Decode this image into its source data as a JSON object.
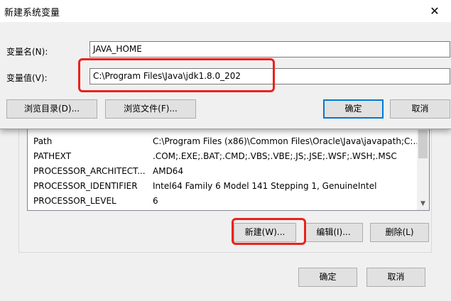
{
  "dialog": {
    "title": "新建系统变量",
    "variable_name_label": "变量名(N):",
    "variable_name_value": "JAVA_HOME",
    "variable_value_label": "变量值(V):",
    "variable_value_value": "C:\\Program Files\\Java\\jdk1.8.0_202",
    "browse_directory_button": "浏览目录(D)...",
    "browse_file_button": "浏览文件(F)...",
    "ok_button": "确定",
    "cancel_button": "取消"
  },
  "system_variables": {
    "rows": [
      {
        "name": "Path",
        "value": "C:\\Program Files (x86)\\Common Files\\Oracle\\Java\\javapath;C:..."
      },
      {
        "name": "PATHEXT",
        "value": ".COM;.EXE;.BAT;.CMD;.VBS;.VBE;.JS;.JSE;.WSF;.WSH;.MSC"
      },
      {
        "name": "PROCESSOR_ARCHITECT...",
        "value": "AMD64"
      },
      {
        "name": "PROCESSOR_IDENTIFIER",
        "value": "Intel64 Family 6 Model 141 Stepping 1, GenuineIntel"
      },
      {
        "name": "PROCESSOR_LEVEL",
        "value": "6"
      }
    ],
    "new_button": "新建(W)...",
    "edit_button": "编辑(I)...",
    "delete_button": "删除(L)"
  },
  "footer": {
    "ok_button": "确定",
    "cancel_button": "取消"
  },
  "colors": {
    "highlight": "#e8231c",
    "focus": "#0078d7"
  }
}
